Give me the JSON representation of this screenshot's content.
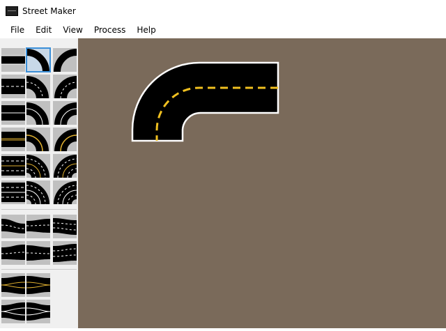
{
  "window": {
    "title": "Street Maker",
    "icon": "street-maker-app-icon"
  },
  "menu": {
    "file": "File",
    "edit": "Edit",
    "view": "View",
    "process": "Process",
    "help": "Help"
  },
  "palette": {
    "selected_tile": "curve-2lane",
    "sections": [
      "curves-and-straights",
      "lane-shifts",
      "tapers"
    ]
  },
  "canvas": {
    "background": "#7a6a5a",
    "placed_piece": "curve-2lane-dashed-yellow"
  },
  "colors": {
    "asphalt": "#000000",
    "edge_line": "#ffffff",
    "center_line": "#f0c020",
    "tile_bg": "#c0c0c0",
    "selection": "#3b8fd8"
  }
}
